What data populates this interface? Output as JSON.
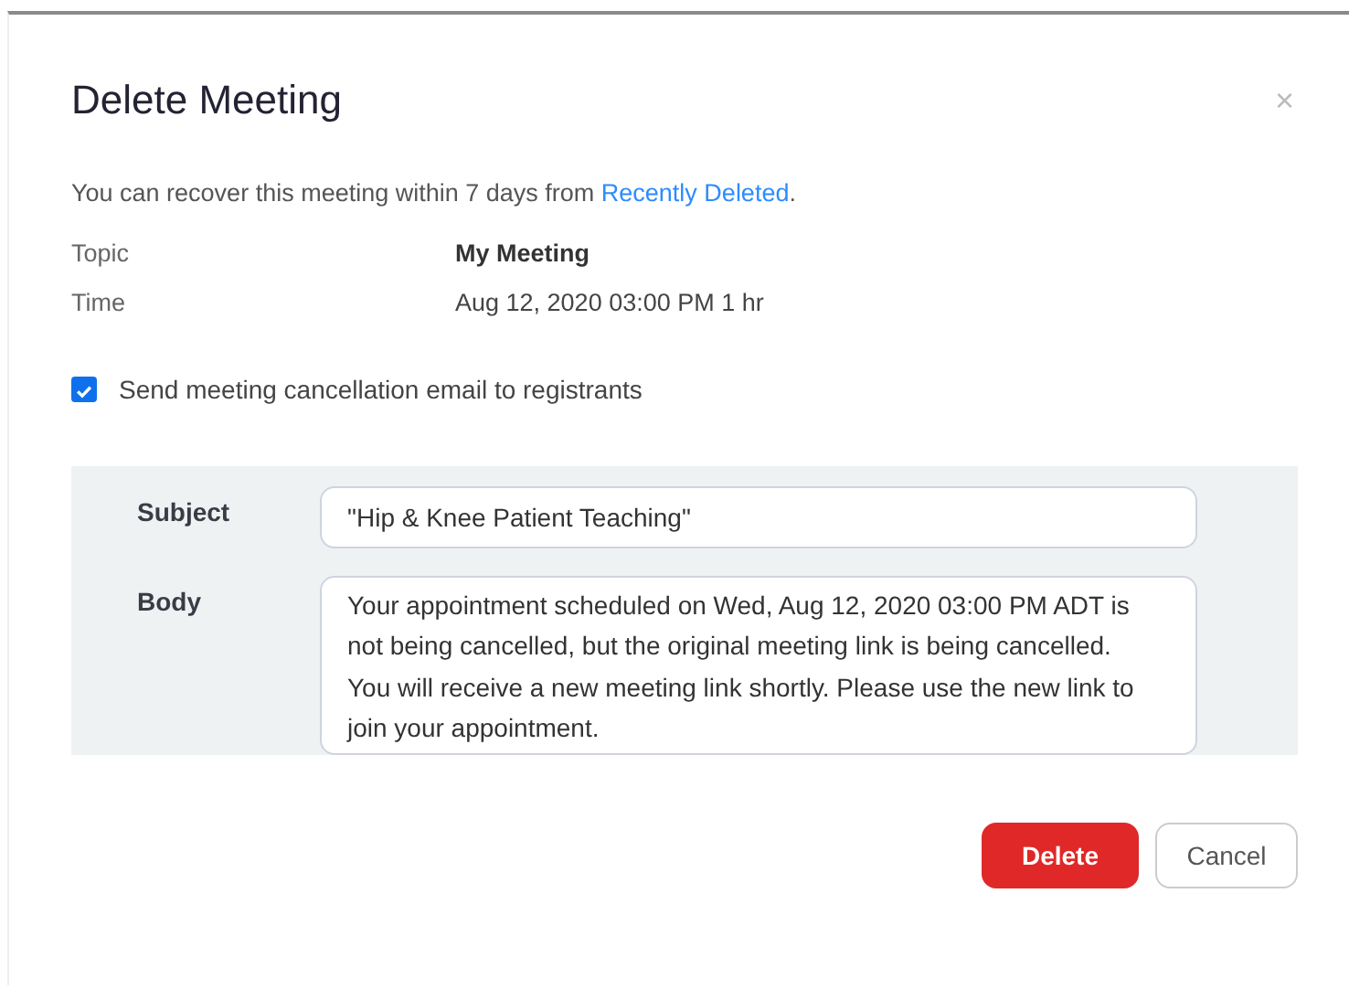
{
  "dialog": {
    "title": "Delete Meeting",
    "close": "×"
  },
  "notice": {
    "text": "You can recover this meeting within 7 days from ",
    "link": "Recently Deleted",
    "end": "."
  },
  "details": [
    {
      "label": "Topic",
      "value": "My Meeting",
      "kind": "bold"
    },
    {
      "label": "Time",
      "value": "Aug 12, 2020 03:00 PM   1 hr",
      "kind": "plain"
    }
  ],
  "send_email": {
    "label": "Send meeting cancellation email to registrants",
    "checked": true
  },
  "email": {
    "subject_label": "Subject",
    "subject": "\"Hip & Knee Patient Teaching\"",
    "body_label": "Body",
    "body": "Your appointment scheduled on Wed, Aug 12, 2020 03:00 PM ADT is not being cancelled, but the original meeting link is being cancelled. You will receive a new meeting link shortly. Please use the new link to join your appointment."
  },
  "buttons": [
    {
      "label": "Delete",
      "kind": "primary"
    },
    {
      "label": "Cancel",
      "kind": "secondary"
    }
  ]
}
